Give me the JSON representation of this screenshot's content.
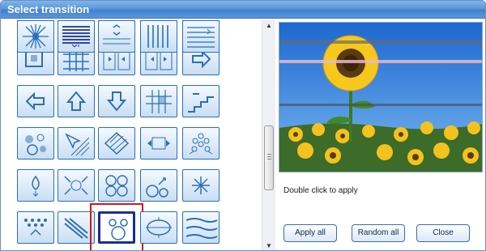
{
  "window": {
    "title": "Select transition"
  },
  "transitions": {
    "selected_index": 27,
    "icons": [
      "partial-top-1",
      "partial-top-2",
      "partial-top-3",
      "partial-top-4",
      "partial-top-5",
      "box-out-icon",
      "grid-icon",
      "door-open-icon",
      "door-close-icon",
      "arrow-right-icon",
      "arrow-left-icon",
      "arrow-up-icon",
      "arrow-down-icon",
      "grid-fill-icon",
      "stairs-icon",
      "circles-icon",
      "cursor-diagonal-icon",
      "diamond-stripes-icon",
      "arrows-out-icon",
      "dots-fan-icon",
      "drop-icon",
      "arrows-in-icon",
      "circles-cluster-icon",
      "circles-burst-icon",
      "star-burst-icon",
      "dots-grid-icon",
      "diagonal-slash-icon",
      "bubbles-icon",
      "ellipse-split-icon",
      "puzzle-stripes-icon",
      "sunburst-icon",
      "horizontal-blinds-icon",
      "vertical-arrows-icon",
      "vertical-blinds-icon",
      "wide-blinds-icon"
    ]
  },
  "preview": {
    "image_name": "sunflower-preview",
    "hint": "Double click to apply"
  },
  "buttons": {
    "apply_all": "Apply all",
    "random_all": "Random all",
    "close": "Close"
  },
  "colors": {
    "title_bar": "#5d98dc",
    "selection_frame": "#d21818",
    "icon_border": "#2a6fb8"
  }
}
